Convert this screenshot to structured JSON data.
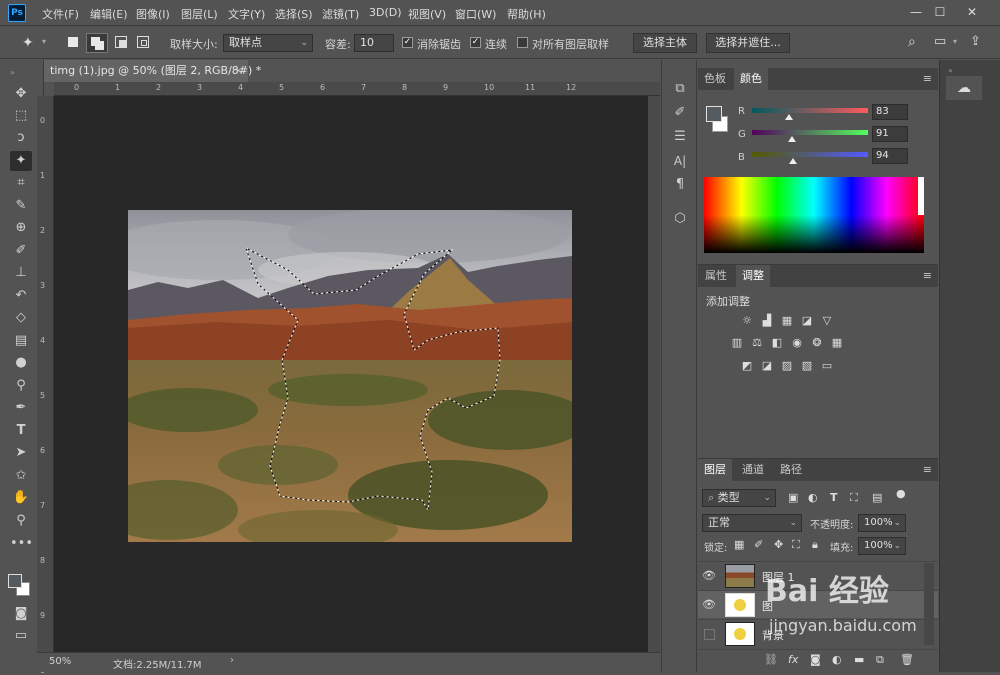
{
  "app": {
    "logo": "Ps"
  },
  "menu": [
    "文件(F)",
    "编辑(E)",
    "图像(I)",
    "图层(L)",
    "文字(Y)",
    "选择(S)",
    "滤镜(T)",
    "3D(D)",
    "视图(V)",
    "窗口(W)",
    "帮助(H)"
  ],
  "window_controls": {
    "minimize": "—",
    "maximize": "☐",
    "close": "✕"
  },
  "options": {
    "sample_size_label": "取样大小:",
    "sample_size_value": "取样点",
    "tolerance_label": "容差:",
    "tolerance_value": "10",
    "antialias_label": "消除锯齿",
    "antialias_checked": true,
    "contiguous_label": "连续",
    "contiguous_checked": true,
    "all_layers_label": "对所有图层取样",
    "all_layers_checked": false,
    "select_subject": "选择主体",
    "select_and_mask": "选择并遮住..."
  },
  "document": {
    "tab_title": "timg (1).jpg @ 50% (图层 2, RGB/8#) *",
    "close": "×",
    "ruler_h_ticks": [
      "0",
      "1",
      "2",
      "3",
      "4",
      "5",
      "6",
      "7",
      "8",
      "9",
      "10",
      "11",
      "12"
    ],
    "ruler_v_ticks": [
      "0",
      "1",
      "2",
      "3",
      "4",
      "5",
      "6",
      "7",
      "8",
      "9",
      "0"
    ]
  },
  "status": {
    "zoom": "50%",
    "doc_info": "文档:2.25M/11.7M",
    "arrow": "›"
  },
  "color_panel": {
    "tabs": [
      "色板",
      "颜色"
    ],
    "active_tab": "颜色",
    "menu_icon": "≡",
    "channels": [
      {
        "label": "R",
        "value": "83",
        "level": 0.325
      },
      {
        "label": "G",
        "value": "91",
        "level": 0.357
      },
      {
        "label": "B",
        "value": "94",
        "level": 0.369
      }
    ],
    "fg_color": "#535b5e",
    "bg_color": "#ffffff"
  },
  "adjustments_panel": {
    "tabs": [
      "属性",
      "调整"
    ],
    "active_tab": "调整",
    "title": "添加调整"
  },
  "layers_panel": {
    "tabs": [
      "图层",
      "通道",
      "路径"
    ],
    "active_tab": "图层",
    "filter_kind": "类型",
    "blend_mode": "正常",
    "opacity_label": "不透明度:",
    "opacity_value": "100%",
    "lock_label": "锁定:",
    "fill_label": "填充:",
    "fill_value": "100%",
    "layers": [
      {
        "name": "图层 1",
        "visible": true
      },
      {
        "name": "图",
        "visible": true
      },
      {
        "name": "背景",
        "visible": false
      }
    ]
  },
  "watermark": {
    "brand": "Bai 经验",
    "url": "jingyan.baidu.com"
  }
}
